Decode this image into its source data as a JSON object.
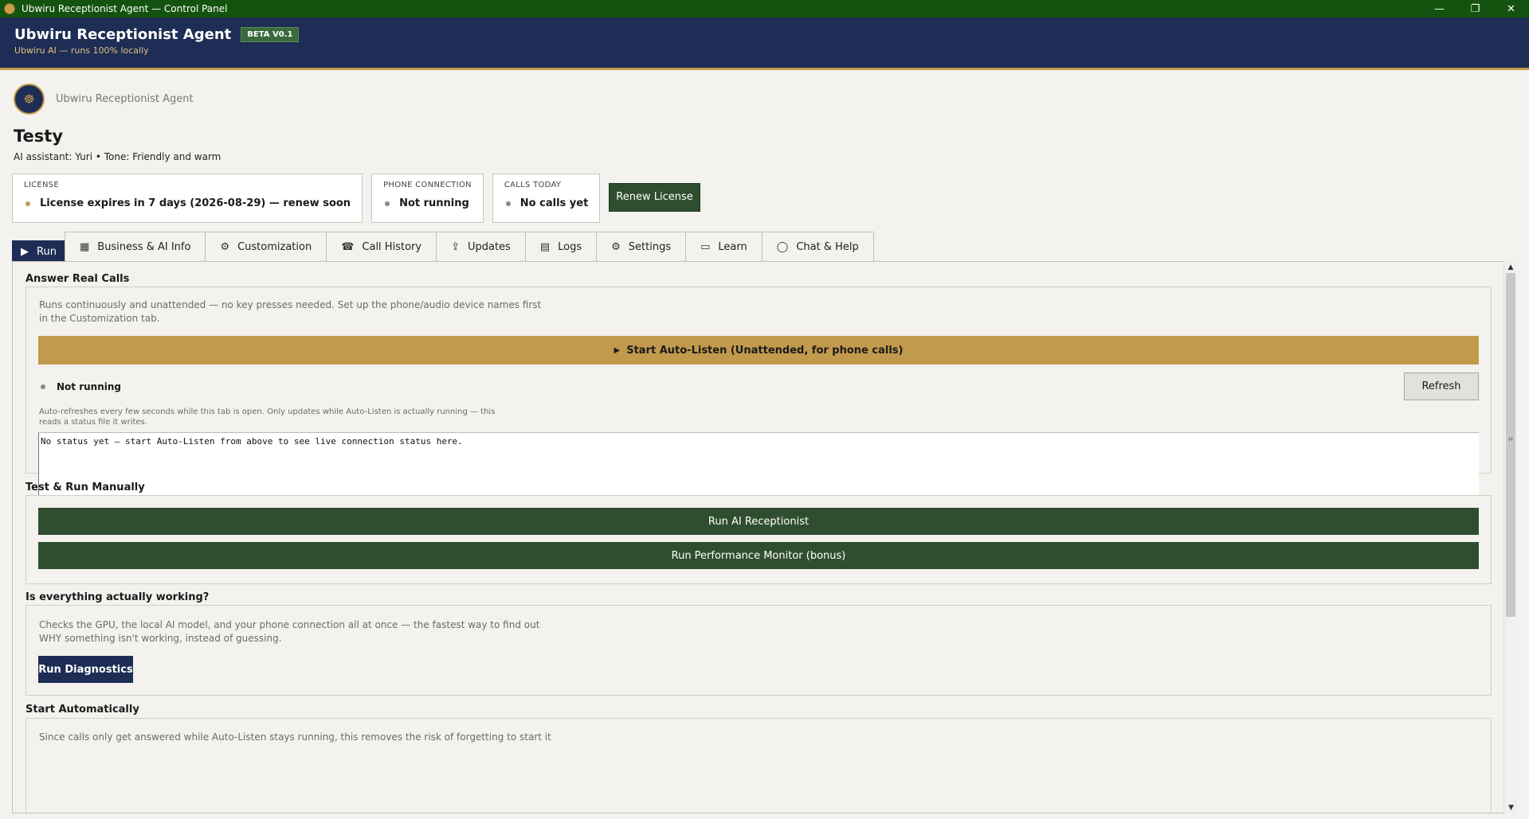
{
  "window": {
    "title": "Ubwiru Receptionist Agent — Control Panel",
    "minimize": "—",
    "restore": "❐",
    "close": "✕"
  },
  "header": {
    "app_name": "Ubwiru Receptionist Agent",
    "badge": "BETA V0.1",
    "subtitle": "Ubwiru AI — runs 100% locally"
  },
  "agent": {
    "label": "Ubwiru Receptionist Agent",
    "logo_glyph": "☸"
  },
  "business": {
    "name": "Testy",
    "meta": "AI assistant: Yuri  •  Tone: Friendly and warm"
  },
  "cards": {
    "license": {
      "label": "LICENSE",
      "value": "License expires in 7 days (2026-08-29) — renew soon",
      "dot_color": "#c29a4d"
    },
    "phone": {
      "label": "PHONE CONNECTION",
      "value": "Not running",
      "dot_color": "#888888"
    },
    "calls": {
      "label": "CALLS TODAY",
      "value": "No calls yet",
      "dot_color": "#888888"
    }
  },
  "renew_button": "Renew License",
  "tabs": [
    {
      "label": "Run",
      "icon": "play-icon",
      "glyph": "▶"
    },
    {
      "label": "Business & AI Info",
      "icon": "building-icon",
      "glyph": "▦"
    },
    {
      "label": "Customization",
      "icon": "gear-icon",
      "glyph": "⚙"
    },
    {
      "label": "Call History",
      "icon": "phone-icon",
      "glyph": "☎"
    },
    {
      "label": "Updates",
      "icon": "upload-icon",
      "glyph": "⇪"
    },
    {
      "label": "Logs",
      "icon": "document-icon",
      "glyph": "▤"
    },
    {
      "label": "Settings",
      "icon": "settings-icon",
      "glyph": "⚙"
    },
    {
      "label": "Learn",
      "icon": "book-icon",
      "glyph": "▭"
    },
    {
      "label": "Chat & Help",
      "icon": "chat-icon",
      "glyph": "◯"
    }
  ],
  "answer_calls": {
    "title": "Answer Real Calls",
    "desc_line1": "Runs continuously and unattended — no key presses needed. Set up the phone/audio device names first",
    "desc_line2": "in the Customization tab.",
    "start_button": "Start Auto-Listen (Unattended, for phone calls)",
    "status": "Not running",
    "refresh_button": "Refresh",
    "note_line1": "Auto-refreshes every few seconds while this tab is open. Only updates while Auto-Listen is actually running — this",
    "note_line2": "reads a status file it writes.",
    "log_text": "No status yet — start Auto-Listen from above to see live connection status here."
  },
  "manual": {
    "title": "Test & Run Manually",
    "run_ai": "Run AI Receptionist",
    "run_monitor": "Run Performance Monitor (bonus)"
  },
  "diagnostics": {
    "title": "Is everything actually working?",
    "desc_line1": "Checks the GPU, the local AI model, and your phone connection all at once — the fastest way to find out",
    "desc_line2": "WHY something isn't working, instead of guessing.",
    "button": "Run Diagnostics"
  },
  "autostart": {
    "title": "Start Automatically",
    "desc_line1": "Since calls only get answered while Auto-Listen stays running, this removes the risk of forgetting to start it"
  }
}
